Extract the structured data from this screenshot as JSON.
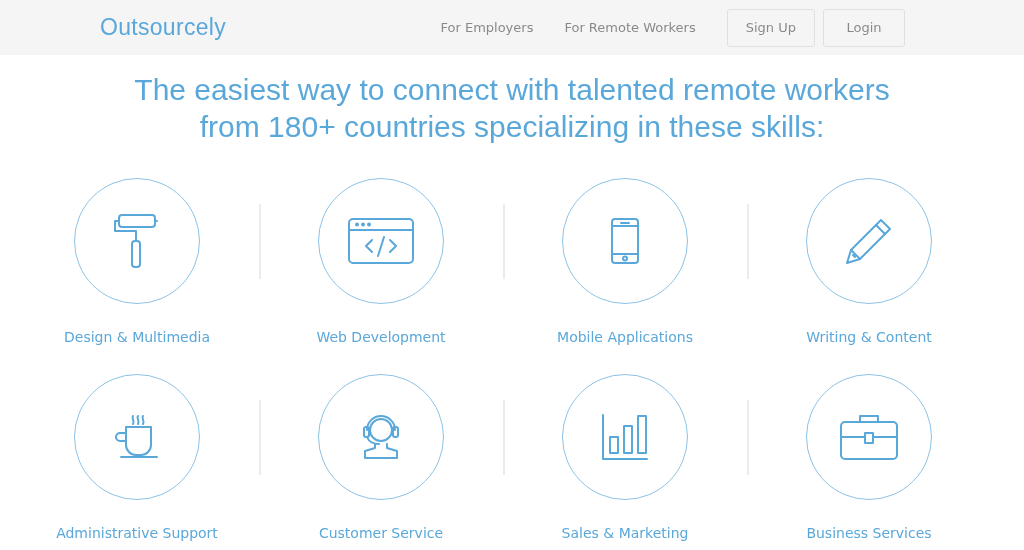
{
  "header": {
    "logo": "Outsourcely",
    "nav": [
      "For Employers",
      "For Remote Workers"
    ],
    "buttons": [
      "Sign Up",
      "Login"
    ]
  },
  "headline": [
    "The easiest way to connect with talented remote workers",
    "from 180+ countries specializing in these skills:"
  ],
  "skills": [
    {
      "kind": "roller",
      "label": "Design & Multimedia"
    },
    {
      "kind": "code",
      "label": "Web Development"
    },
    {
      "kind": "phone",
      "label": "Mobile Applications"
    },
    {
      "kind": "pencil",
      "label": "Writing & Content"
    },
    {
      "kind": "cup",
      "label": "Administrative Support"
    },
    {
      "kind": "headset",
      "label": "Customer Service"
    },
    {
      "kind": "chart",
      "label": "Sales & Marketing"
    },
    {
      "kind": "briefcase",
      "label": "Business Services"
    }
  ]
}
